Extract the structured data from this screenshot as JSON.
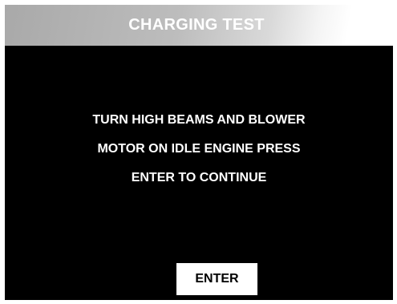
{
  "header": {
    "title": "CHARGING TEST"
  },
  "message": {
    "lines": [
      "TURN HIGH BEAMS AND BLOWER",
      "MOTOR ON IDLE ENGINE PRESS",
      "ENTER TO CONTINUE"
    ]
  },
  "actions": {
    "enter_label": "ENTER"
  },
  "colors": {
    "screen_background": "#000000",
    "title_gradient_start": "#a9a9a9",
    "title_gradient_end": "#ffffff",
    "text": "#ffffff",
    "button_background": "#ffffff",
    "button_text": "#000000"
  }
}
